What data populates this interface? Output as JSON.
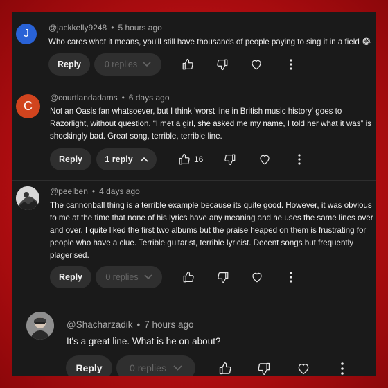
{
  "colors": {
    "accent_bg": "#c3100f",
    "panel": "#1a1a1a",
    "pill": "#2f2f2f"
  },
  "comments": [
    {
      "author": "@jackkelly9248",
      "time": "5 hours ago",
      "avatar_letter": "J",
      "avatar_color": "#2962d6",
      "text": "Who cares what it means, you'll still have thousands of people paying to sing it in a field 😂",
      "reply_label": "Reply",
      "replies_label": "0 replies",
      "more_icon": "more-vertical-icon"
    },
    {
      "author": "@courtlandadams",
      "time": "6 days ago",
      "avatar_letter": "C",
      "avatar_color": "#d1441e",
      "text": "Not an Oasis fan whatsoever, but I think 'worst line in British music history' goes to Razorlight, without question. “I met a girl, she asked me my name, I told her what it was” is shockingly bad. Great song, terrible, terrible line.",
      "reply_label": "Reply",
      "replies_label": "1 reply",
      "likes": "16"
    },
    {
      "author": "@peelben",
      "time": "4 days ago",
      "text": "The cannonball thing is a terrible example because its quite good. However, it was obvious to me at the time that none of his lyrics have any meaning and he uses the same lines over and over. I quite liked the first two albums but the praise heaped on them is frustrating for people who have a clue. Terrible guitarist, terrible lyricist. Decent songs but frequently plagerised.",
      "reply_label": "Reply",
      "replies_label": "0 replies"
    },
    {
      "author": "@Shacharzadik",
      "time": "7 hours ago",
      "text": "It's a great line. What is he on about?",
      "reply_label": "Reply",
      "replies_label": "0 replies"
    }
  ]
}
